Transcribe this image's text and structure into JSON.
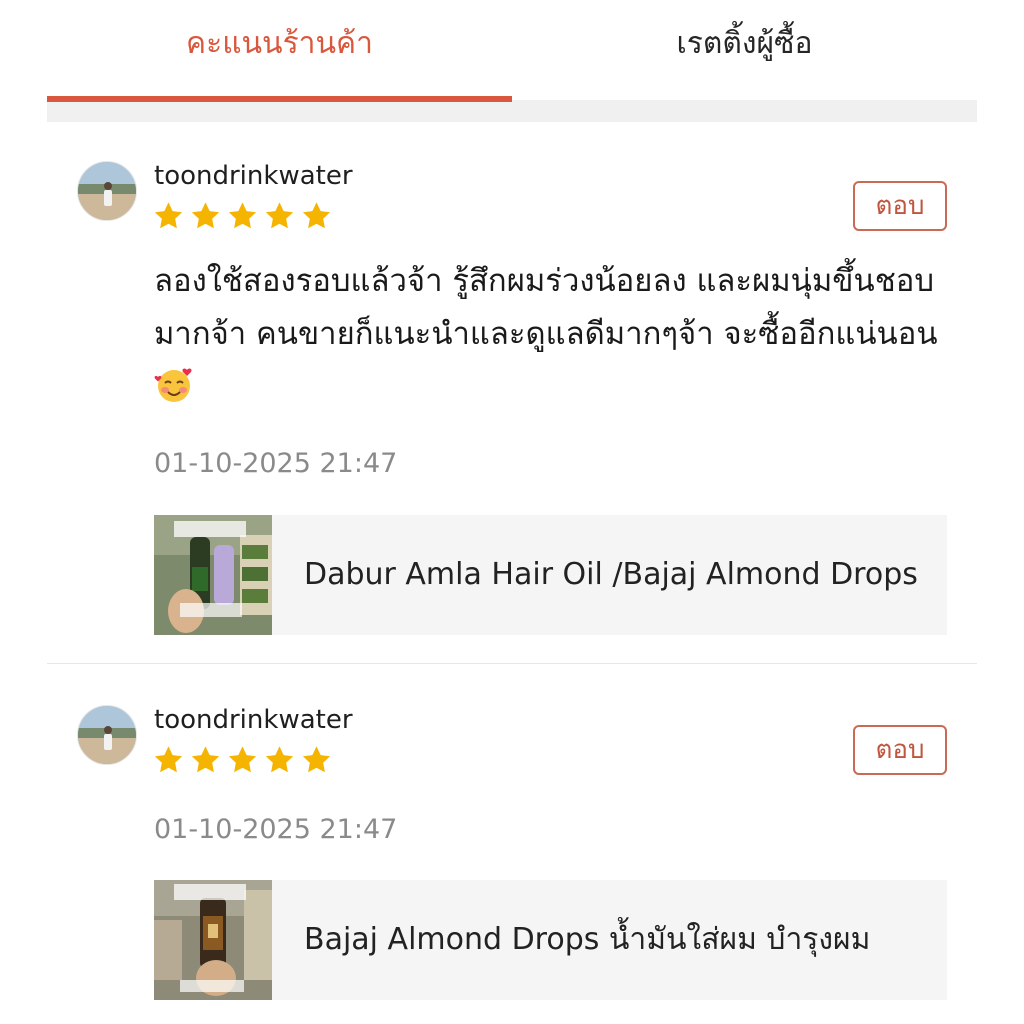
{
  "tabs": {
    "shop_rating": "คะแนนร้านค้า",
    "buyer_rating": "เรตติ้งผู้ซื้อ",
    "active": "shop_rating"
  },
  "colors": {
    "accent": "#d9573c",
    "star": "#f5b400",
    "reply_border": "#c96a55"
  },
  "reviews": [
    {
      "username": "toondrinkwater",
      "rating": 5,
      "reply_label": "ตอบ",
      "text": "ลองใช้สองรอบแล้วจ้า รู้สึกผมร่วงน้อยลง และผมนุ่มขึ้นชอบมากจ้า คนขายก็แนะนำและดูแลดีมากๆจ้า จะซื้ออีกแน่นอน",
      "emoji": "smiling-face-with-hearts",
      "timestamp": "01-10-2025 21:47",
      "product_name": "Dabur Amla Hair Oil /Bajaj Almond Drops"
    },
    {
      "username": "toondrinkwater",
      "rating": 5,
      "reply_label": "ตอบ",
      "text": "",
      "timestamp": "01-10-2025 21:47",
      "product_name": "Bajaj Almond Drops น้ำมันใส่ผม บำรุงผม"
    }
  ]
}
